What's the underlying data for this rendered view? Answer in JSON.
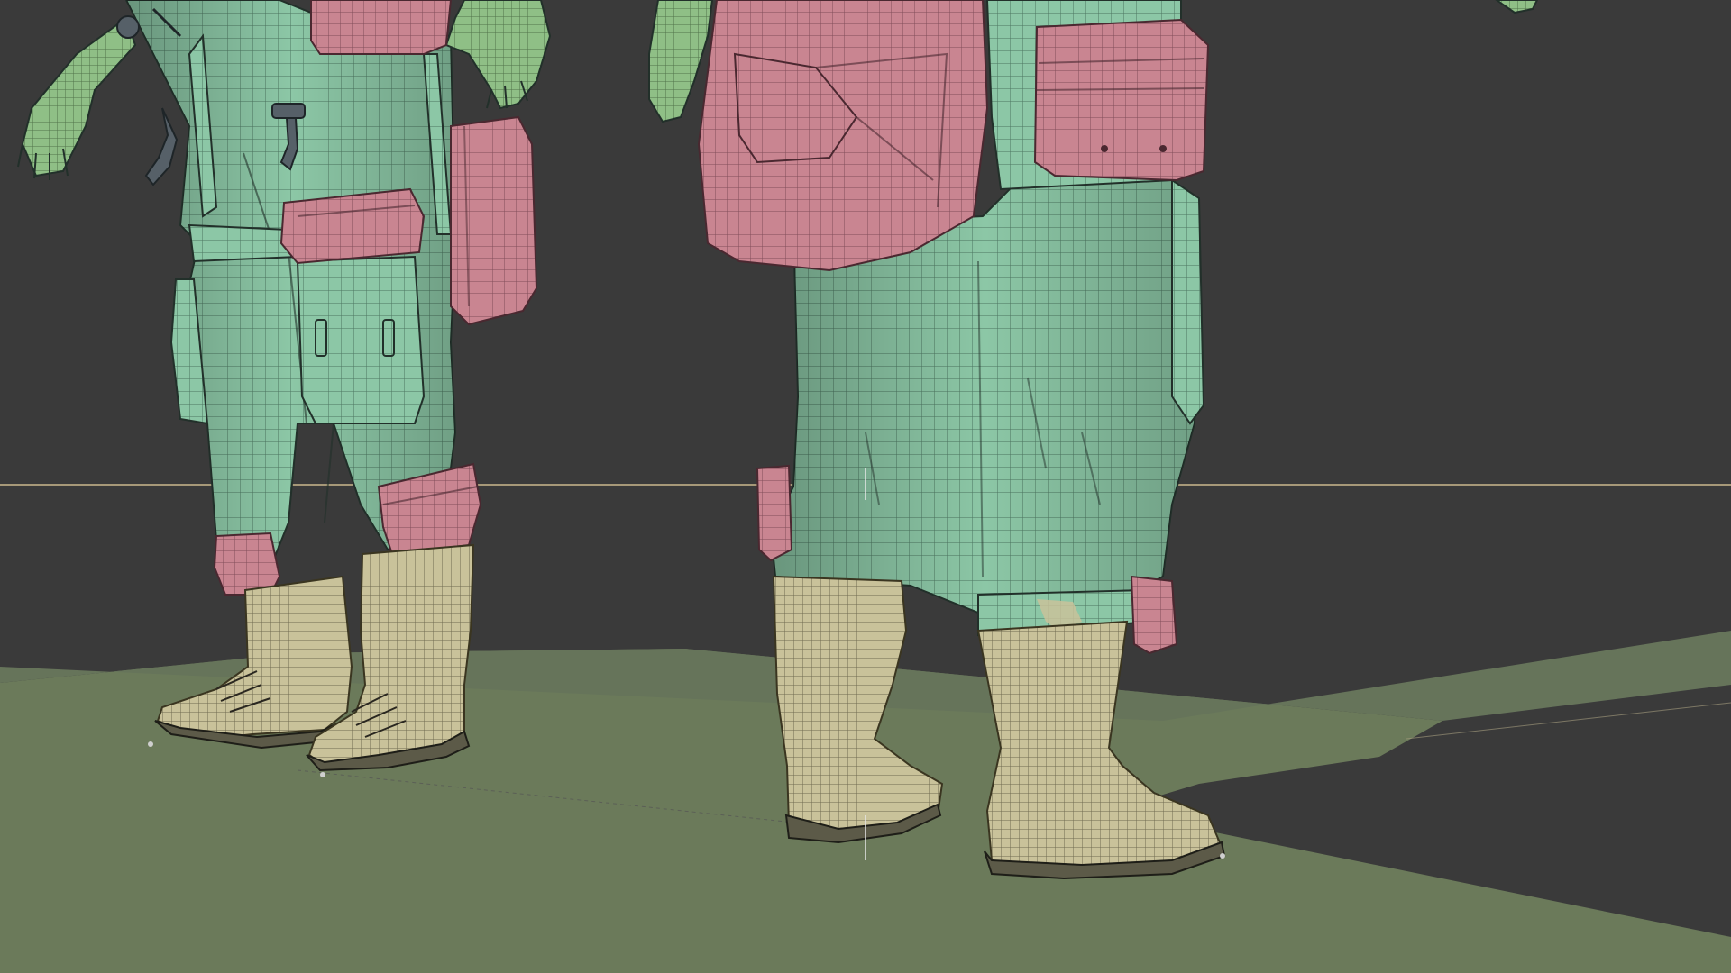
{
  "viewport": {
    "mode": "wireframe-overlay",
    "background_color": "#3a3a3a",
    "floor_color": "#6b7a5a",
    "horizon_color": "#c9b88c"
  },
  "materials": {
    "cloth": "#8cc7a6",
    "pouch": "#c98591",
    "boot": "#c9c29a",
    "hand": "#8fbf86"
  },
  "objects": [
    {
      "id": "character-front",
      "parts": [
        "pants",
        "belt-pouches",
        "thigh-pouch",
        "knee-pouches",
        "boots",
        "gloves",
        "straps-and-clips"
      ]
    },
    {
      "id": "character-back",
      "parts": [
        "pants",
        "backpack-pouch",
        "hip-pouch",
        "ankle-strap",
        "boots",
        "gloves"
      ]
    }
  ]
}
